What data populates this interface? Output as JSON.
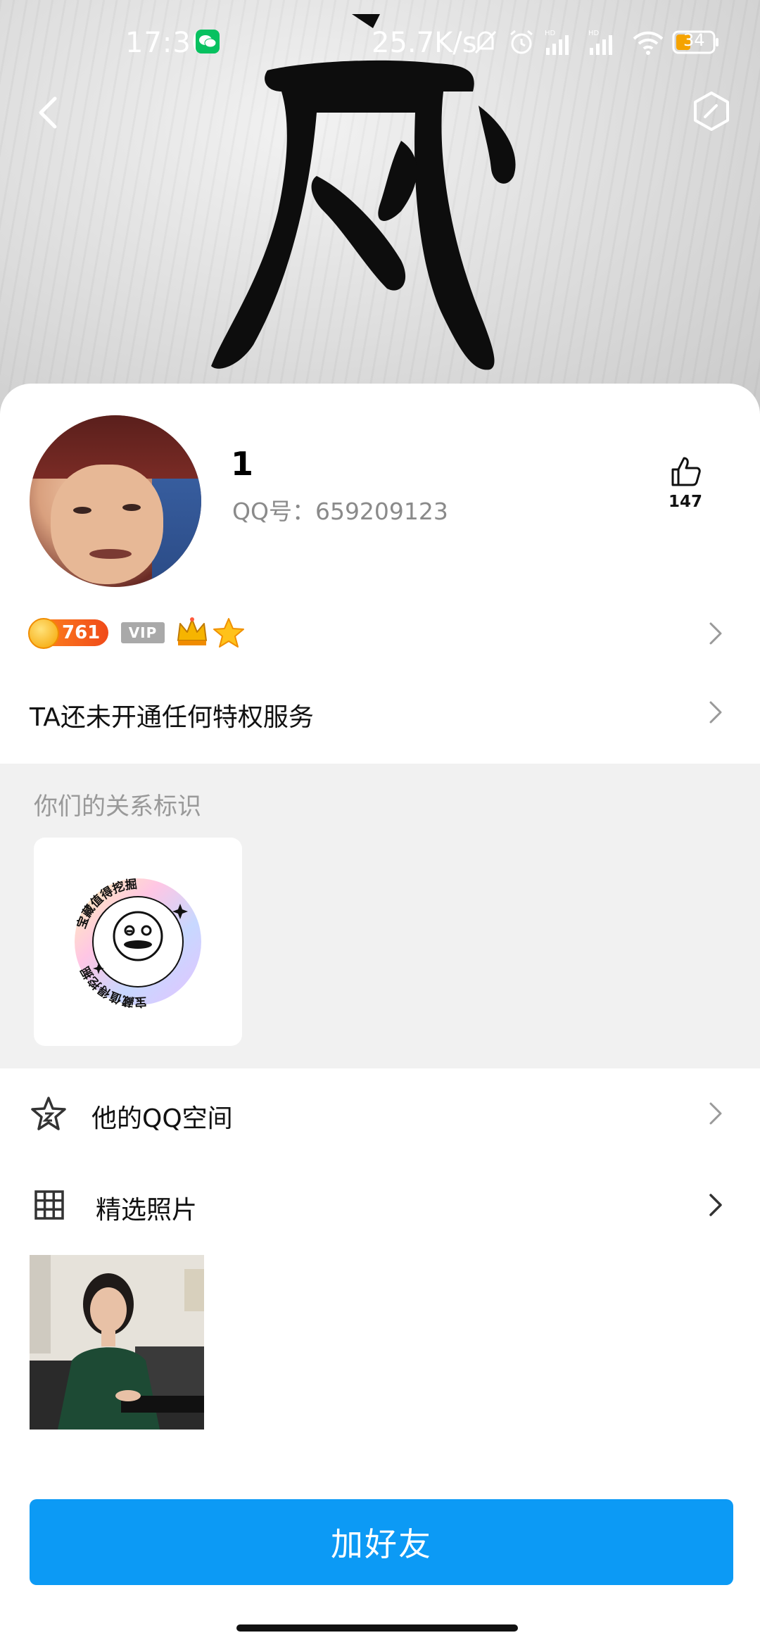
{
  "status_bar": {
    "time": "17:30",
    "network_speed": "25.7K/s",
    "battery": "34"
  },
  "profile": {
    "nickname": "1",
    "qq_number": "QQ号：659209123",
    "likes": "147",
    "level": "761",
    "vip_label": "VIP",
    "privilege_text": "TA还未开通任何特权服务"
  },
  "relation": {
    "section_title": "你们的关系标识",
    "badge_text": "宝藏值得挖掘"
  },
  "menu": {
    "qzone_label": "他的QQ空间",
    "photos_label": "精选照片"
  },
  "actions": {
    "add_friend_label": "加好友"
  },
  "colors": {
    "primary_button": "#0c9af5",
    "level_badge": "#f04a1a",
    "background_section": "#f1f1f1"
  }
}
